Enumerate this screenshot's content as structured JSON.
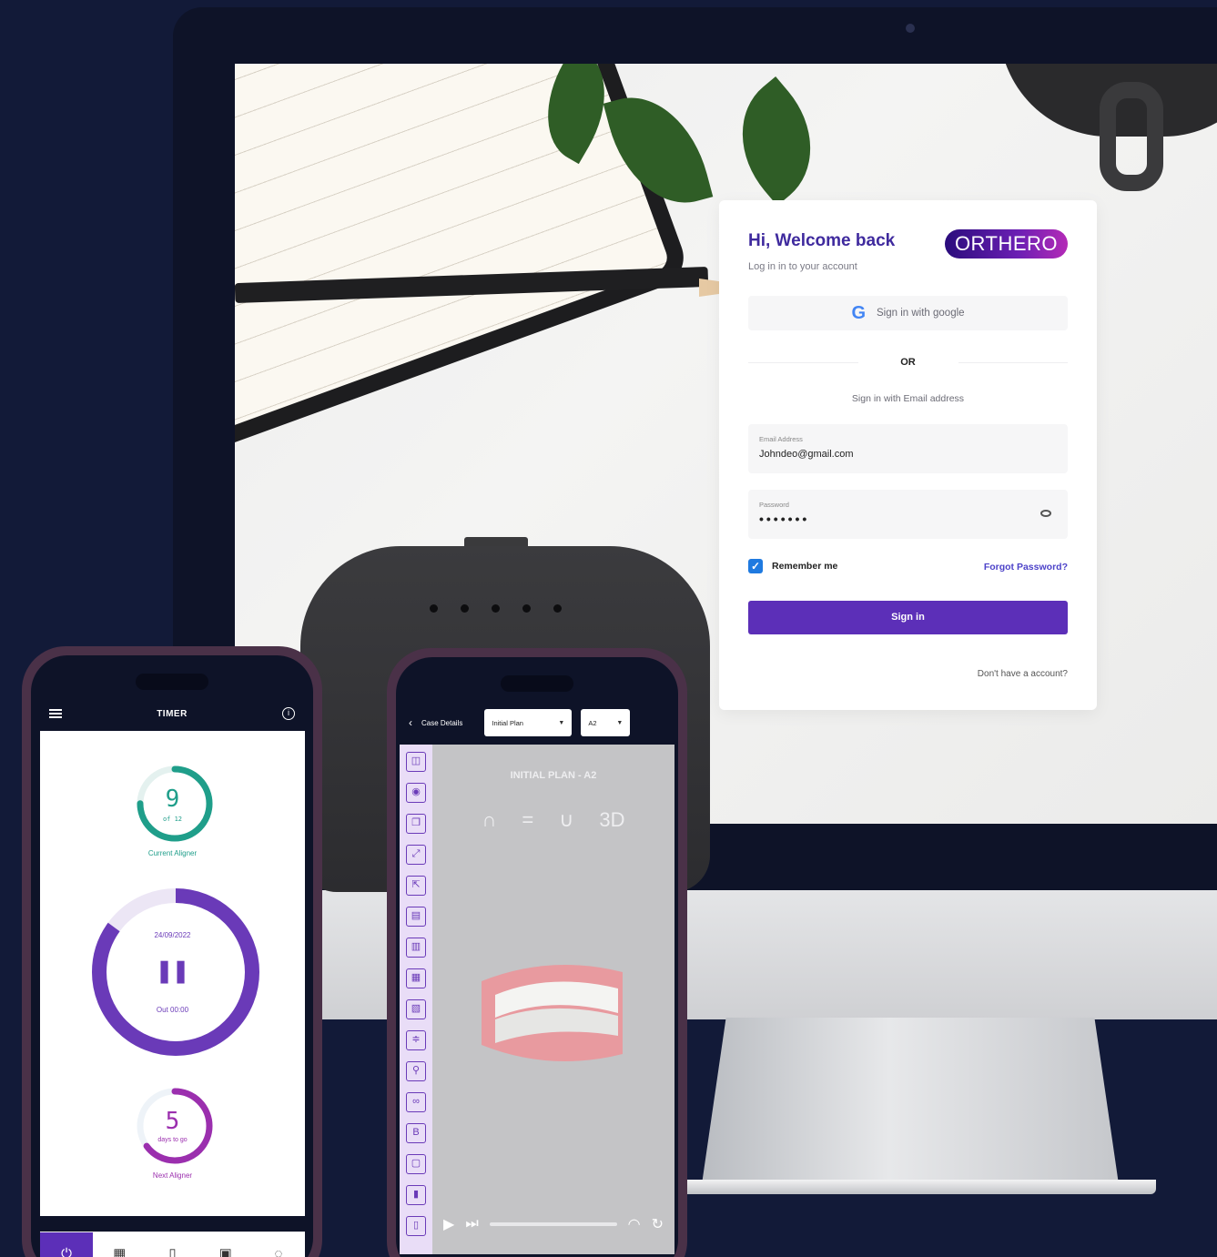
{
  "login": {
    "greeting": "Hi, Welcome back",
    "subtitle": "Log in in to your account",
    "brand_logo": "ORTHERO",
    "google_button": "Sign in with google",
    "divider": "OR",
    "email_hint": "Sign in with Email address",
    "email": {
      "label": "Email Address",
      "value": "Johndeo@gmail.com"
    },
    "password": {
      "label": "Password",
      "value": "•••••••"
    },
    "remember_me": "Remember me",
    "remember_checked": true,
    "forgot_password": "Forgot Password?",
    "signin_button": "Sign in",
    "no_account": "Don't have a account?"
  },
  "timer_app": {
    "title": "TIMER",
    "current_aligner": {
      "number": "9",
      "of": "of 12",
      "label": "Current Aligner",
      "progress": 0.75
    },
    "main_timer": {
      "date": "24/09/2022",
      "status": "Out 00:00",
      "progress": 0.85
    },
    "next_aligner": {
      "days": "5",
      "days_label": "days to go",
      "label": "Next Aligner",
      "progress": 0.65
    },
    "nav": [
      "timer-icon",
      "calendar-icon",
      "aligner-icon",
      "report-icon",
      "chat-icon"
    ]
  },
  "case_app": {
    "title": "Case Details",
    "plan_dropdown": "Initial Plan",
    "stage_dropdown": "A2",
    "plan_label": "INITIAL PLAN - A2",
    "views": [
      "∩",
      "=",
      "∪",
      "3D"
    ],
    "tools": [
      "◫",
      "◉",
      "❐",
      "⤢",
      "⇱",
      "▤",
      "▥",
      "▦",
      "▧",
      "≑",
      "⚲",
      "∞",
      "B",
      "▢",
      "▮",
      "▯"
    ]
  },
  "colors": {
    "background": "#121a38",
    "brand_purple": "#5c2fb8",
    "teal": "#1f9e8a",
    "magenta": "#9b2fae"
  }
}
